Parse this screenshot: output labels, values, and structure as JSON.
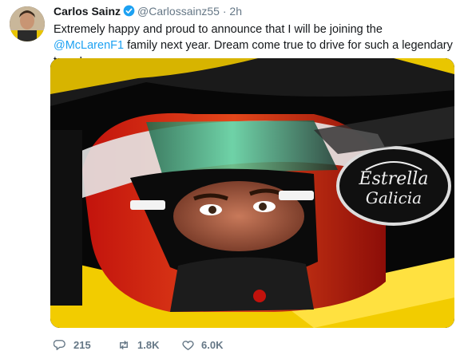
{
  "tweet": {
    "author_name": "Carlos Sainz",
    "author_handle": "@Carlossainz55",
    "separator": "·",
    "time": "2h",
    "text_before_mention": "Extremely happy and proud to announce that I will be joining the ",
    "mention": "@McLarenF1",
    "text_after_mention": " family next year. Dream come true to drive for such a legendary team!"
  },
  "media": {
    "sponsor_logo": "Estrella Galicia 0,0"
  },
  "actions": {
    "replies": "215",
    "retweets": "1.8K",
    "likes": "6.0K"
  },
  "icons": [
    "verified-badge-icon",
    "reply-icon",
    "retweet-icon",
    "like-icon"
  ],
  "colors": {
    "link": "#1da1f2",
    "muted": "#657786",
    "text": "#14171a"
  }
}
